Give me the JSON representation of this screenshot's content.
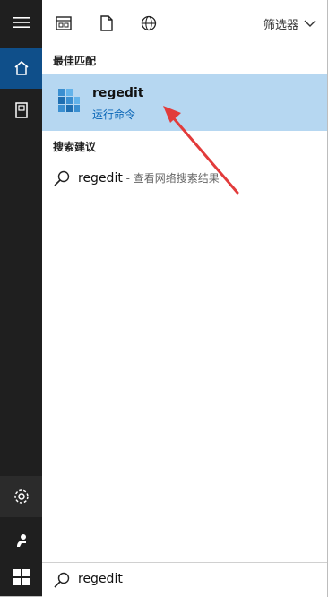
{
  "rail": {
    "items": [
      {
        "icon": "hamburger-menu-icon"
      },
      {
        "icon": "home-icon"
      },
      {
        "icon": "document-icon"
      },
      {
        "icon": "settings-icon"
      },
      {
        "icon": "feedback-icon"
      },
      {
        "icon": "windows-start-icon"
      }
    ]
  },
  "toolbar": {
    "icons": [
      "apps-filter-icon",
      "documents-filter-icon",
      "web-filter-icon"
    ],
    "filter_label": "筛选器"
  },
  "best_match": {
    "title": "最佳匹配",
    "app_name": "regedit",
    "app_sub": "运行命令"
  },
  "suggestions": {
    "title": "搜索建议",
    "items": [
      {
        "term": "regedit",
        "desc": " - 查看网络搜索结果"
      }
    ]
  },
  "search": {
    "value": "regedit"
  },
  "colors": {
    "accent": "#0f4f8a",
    "highlight": "#b6d7f1",
    "annotation": "#e23b3b"
  }
}
